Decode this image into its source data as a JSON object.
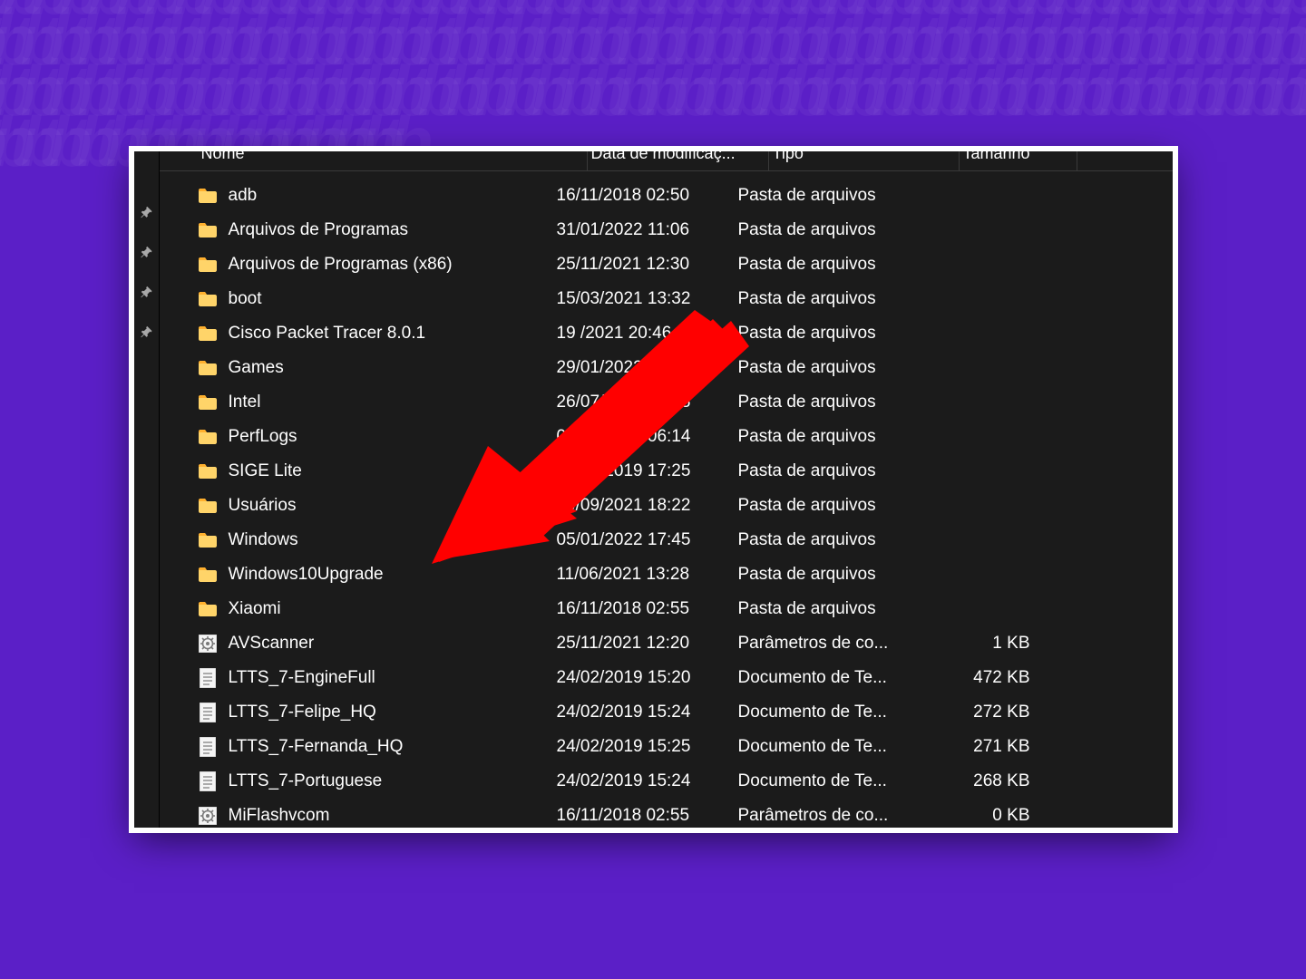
{
  "columns": {
    "name": "Nome",
    "date": "Data de modificaç...",
    "type": "Tipo",
    "size": "Tamanho"
  },
  "icons": {
    "folder": "folder-icon",
    "text": "text-file-icon",
    "ini": "ini-file-icon"
  },
  "rows": [
    {
      "icon": "folder",
      "name": "adb",
      "date": "16/11/2018 02:50",
      "type": "Pasta de arquivos",
      "size": ""
    },
    {
      "icon": "folder",
      "name": "Arquivos de Programas",
      "date": "31/01/2022 11:06",
      "type": "Pasta de arquivos",
      "size": ""
    },
    {
      "icon": "folder",
      "name": "Arquivos de Programas (x86)",
      "date": "25/11/2021 12:30",
      "type": "Pasta de arquivos",
      "size": ""
    },
    {
      "icon": "folder",
      "name": "boot",
      "date": "15/03/2021 13:32",
      "type": "Pasta de arquivos",
      "size": ""
    },
    {
      "icon": "folder",
      "name": "Cisco Packet Tracer 8.0.1",
      "date": "19     /2021 20:46",
      "type": "Pasta de arquivos",
      "size": ""
    },
    {
      "icon": "folder",
      "name": "Games",
      "date": "29/01/2022 18:07",
      "type": "Pasta de arquivos",
      "size": ""
    },
    {
      "icon": "folder",
      "name": "Intel",
      "date": "26/07/2017 22:18",
      "type": "Pasta de arquivos",
      "size": ""
    },
    {
      "icon": "folder",
      "name": "PerfLogs",
      "date": "07/12/2019 06:14",
      "type": "Pasta de arquivos",
      "size": ""
    },
    {
      "icon": "folder",
      "name": "SIGE Lite",
      "date": "18/10/2019 17:25",
      "type": "Pasta de arquivos",
      "size": ""
    },
    {
      "icon": "folder",
      "name": "Usuários",
      "date": "29/09/2021 18:22",
      "type": "Pasta de arquivos",
      "size": ""
    },
    {
      "icon": "folder",
      "name": "Windows",
      "date": "05/01/2022 17:45",
      "type": "Pasta de arquivos",
      "size": ""
    },
    {
      "icon": "folder",
      "name": "Windows10Upgrade",
      "date": "11/06/2021 13:28",
      "type": "Pasta de arquivos",
      "size": ""
    },
    {
      "icon": "folder",
      "name": "Xiaomi",
      "date": "16/11/2018 02:55",
      "type": "Pasta de arquivos",
      "size": ""
    },
    {
      "icon": "ini",
      "name": "AVScanner",
      "date": "25/11/2021 12:20",
      "type": "Parâmetros de co...",
      "size": "1 KB"
    },
    {
      "icon": "text",
      "name": "LTTS_7-EngineFull",
      "date": "24/02/2019 15:20",
      "type": "Documento de Te...",
      "size": "472 KB"
    },
    {
      "icon": "text",
      "name": "LTTS_7-Felipe_HQ",
      "date": "24/02/2019 15:24",
      "type": "Documento de Te...",
      "size": "272 KB"
    },
    {
      "icon": "text",
      "name": "LTTS_7-Fernanda_HQ",
      "date": "24/02/2019 15:25",
      "type": "Documento de Te...",
      "size": "271 KB"
    },
    {
      "icon": "text",
      "name": "LTTS_7-Portuguese",
      "date": "24/02/2019 15:24",
      "type": "Documento de Te...",
      "size": "268 KB"
    },
    {
      "icon": "ini",
      "name": "MiFlashvcom",
      "date": "16/11/2018 02:55",
      "type": "Parâmetros de co...",
      "size": "0 KB"
    }
  ],
  "annotation": {
    "arrow_color": "#ff0000",
    "target_row_name": "Windows"
  }
}
